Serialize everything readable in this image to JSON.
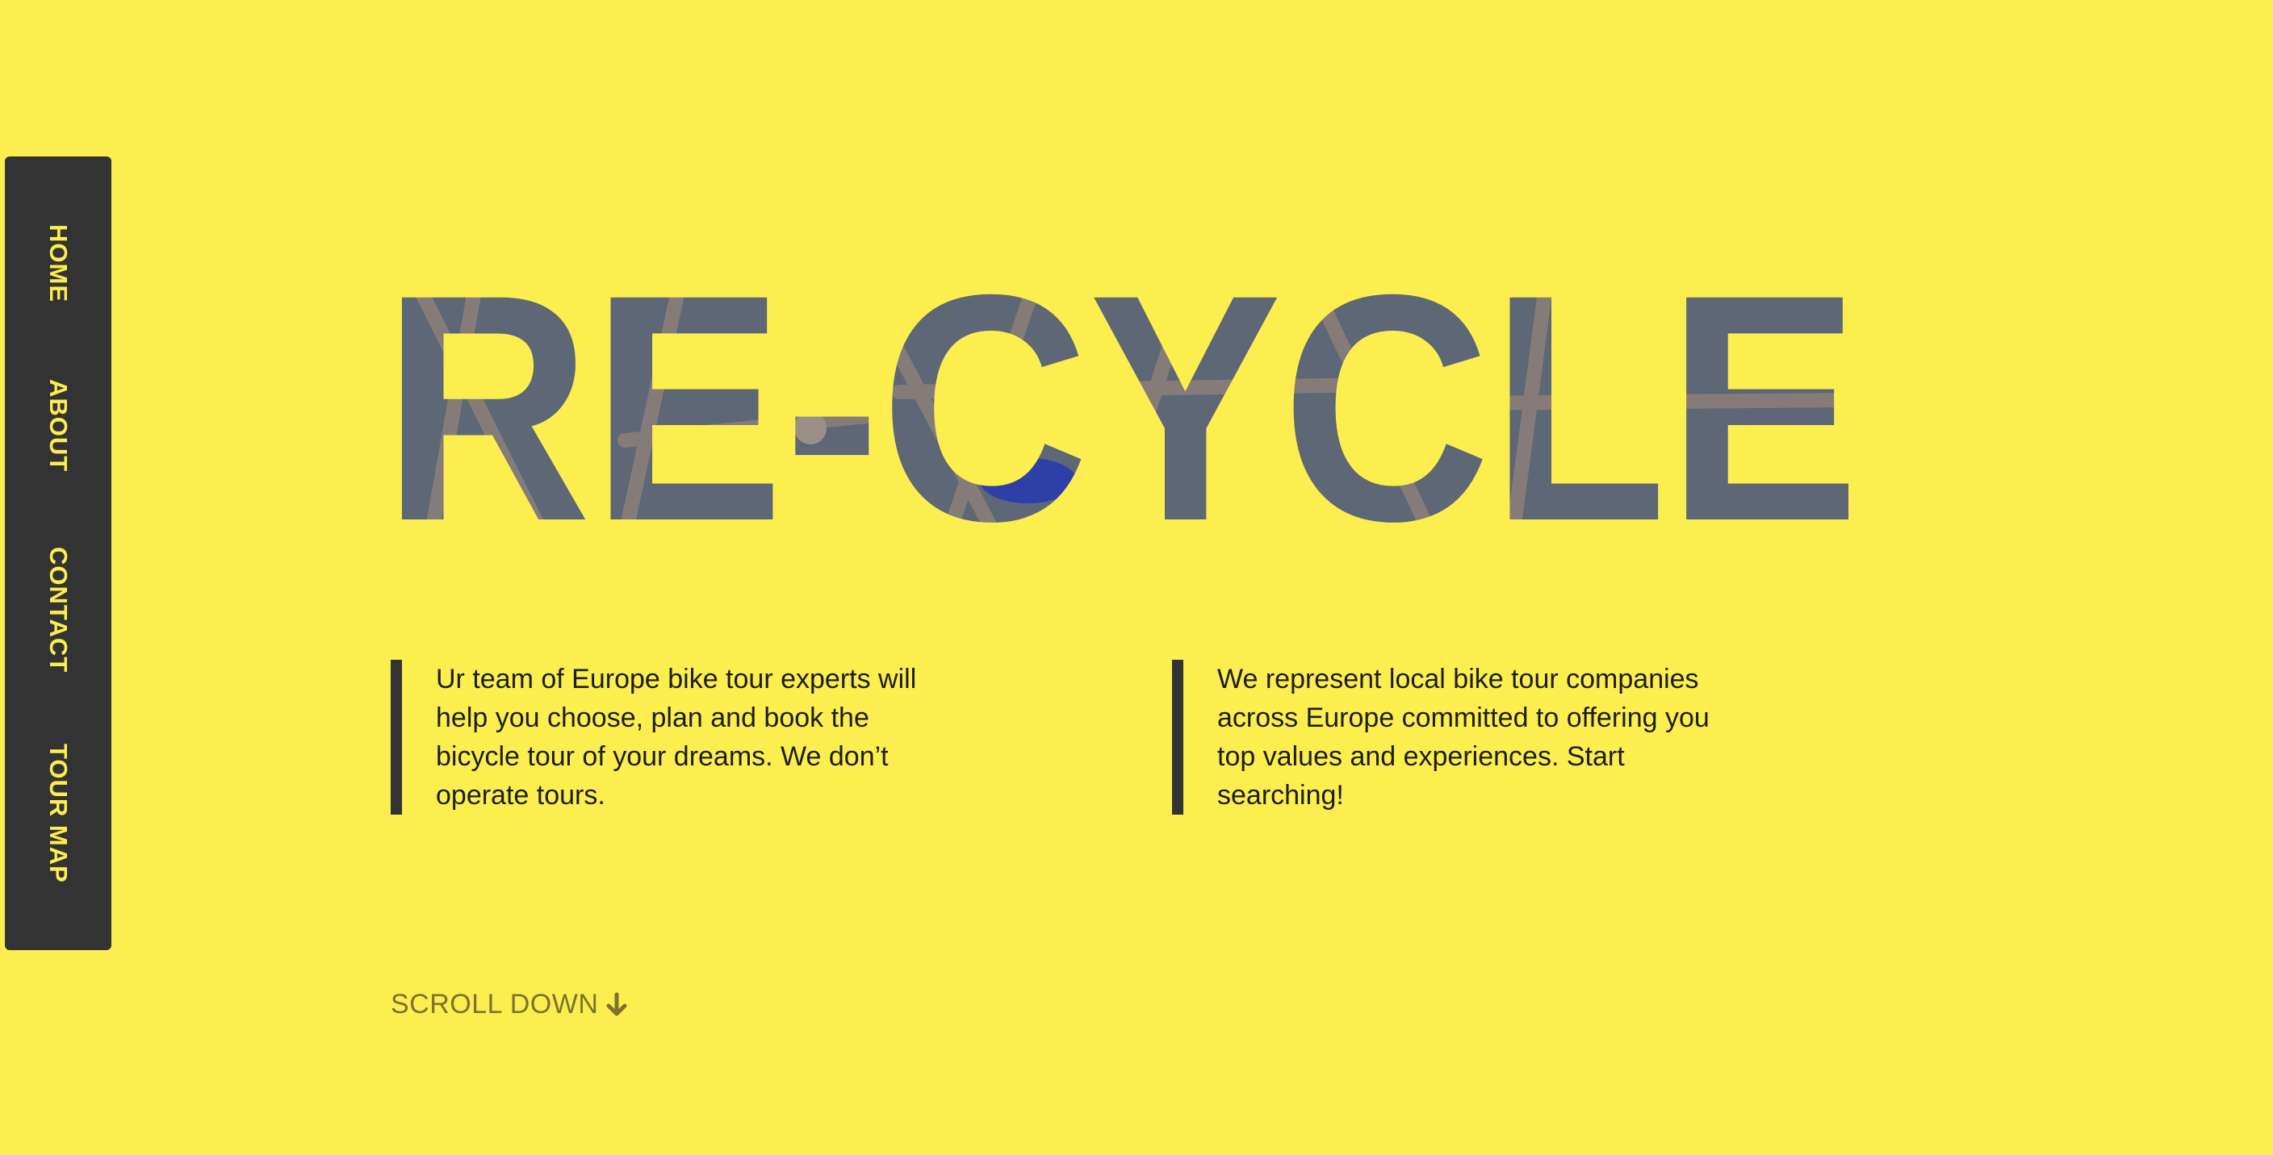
{
  "nav": {
    "items": [
      {
        "label": "HOME"
      },
      {
        "label": "ABOUT"
      },
      {
        "label": "CONTACT"
      },
      {
        "label": "TOUR MAP"
      }
    ]
  },
  "hero": {
    "title": "RE-CYCLE"
  },
  "columns": {
    "left": "Ur team of Europe bike tour experts will help you choose, plan and book the bicycle tour of your dreams. We don’t operate tours.",
    "right": "We represent local bike tour companies across Europe committed to offering you top values and experiences. Start searching!"
  },
  "scroll": {
    "label": "SCROLL DOWN",
    "icon": "arrow-down-icon"
  },
  "colors": {
    "background": "#fcee4f",
    "sidebar": "#333333",
    "title_fill": "#5d6776",
    "accent_text": "#fcee4f"
  }
}
